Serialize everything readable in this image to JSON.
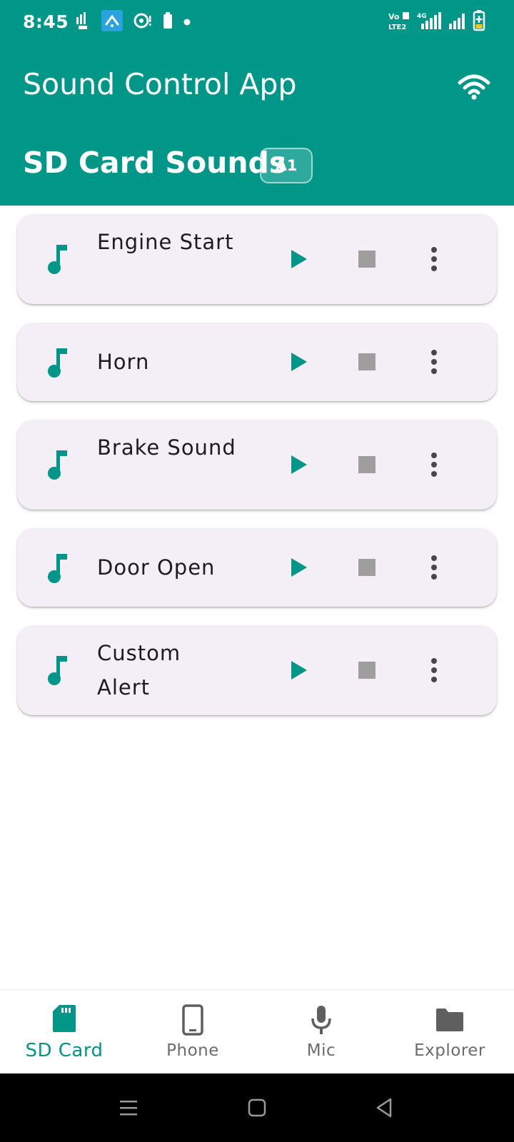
{
  "status_bar": {
    "time": "8:45",
    "left_icons": [
      "sim-signal-icon",
      "messaging-app-icon",
      "sync-alert-icon",
      "battery-small-icon",
      "dot-icon"
    ],
    "right_icons": [
      "volte-icon",
      "signal-4g-icon",
      "signal-bars-icon",
      "battery-charging-icon"
    ],
    "volte_text": "Vo LTE2",
    "network_text": "4G"
  },
  "app_bar": {
    "title": "Sound Control App",
    "section_title": "SD Card Sounds",
    "badge": "A1",
    "wifi_icon": "wifi-icon"
  },
  "sounds": [
    {
      "name": "Engine Start"
    },
    {
      "name": "Horn"
    },
    {
      "name": "Brake Sound"
    },
    {
      "name": "Door Open"
    },
    {
      "name": "Custom Alert"
    }
  ],
  "bottom_nav": {
    "items": [
      {
        "label": "SD Card",
        "icon": "sd-card-icon",
        "active": true
      },
      {
        "label": "Phone",
        "icon": "phone-icon",
        "active": false
      },
      {
        "label": "Mic",
        "icon": "mic-icon",
        "active": false
      },
      {
        "label": "Explorer",
        "icon": "folder-icon",
        "active": false
      }
    ]
  },
  "colors": {
    "primary": "#009688",
    "card_background": "#f4eff6",
    "stop_gray": "#9e9e9e",
    "inactive_label": "#6b6b6b"
  }
}
